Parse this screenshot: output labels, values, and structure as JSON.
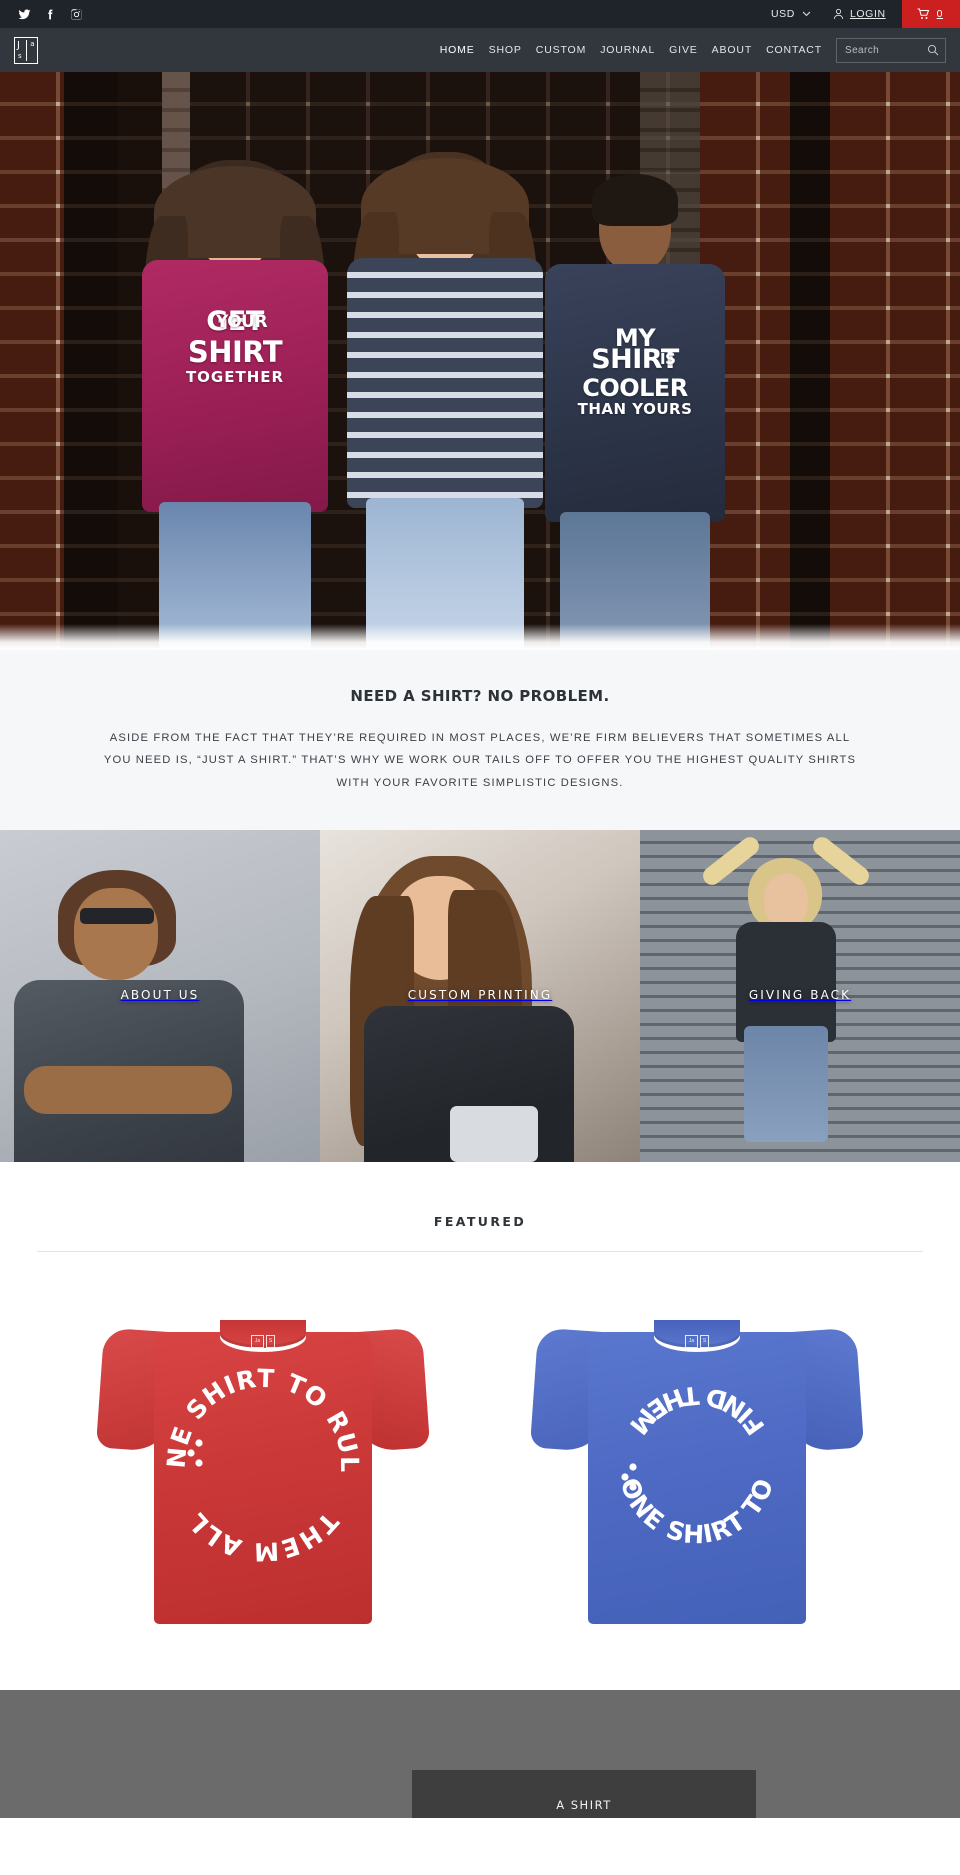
{
  "topbar": {
    "social": [
      {
        "name": "twitter-icon",
        "label": "Twitter"
      },
      {
        "name": "facebook-icon",
        "label": "Facebook"
      },
      {
        "name": "instagram-icon",
        "label": "Instagram"
      }
    ],
    "currency": "USD",
    "login_label": "LOGIN",
    "cart_count": "0",
    "cart_color": "#cc1f1f",
    "background": "#1f242b"
  },
  "header": {
    "background": "#32373e",
    "logo": {
      "line1": "J",
      "line2": "a",
      "line3": "s"
    },
    "nav": [
      {
        "label": "HOME",
        "active": true
      },
      {
        "label": "SHOP",
        "active": false
      },
      {
        "label": "CUSTOM",
        "active": false
      },
      {
        "label": "JOURNAL",
        "active": false
      },
      {
        "label": "GIVE",
        "active": false
      },
      {
        "label": "ABOUT",
        "active": false
      },
      {
        "label": "CONTACT",
        "active": false
      }
    ],
    "search": {
      "placeholder": "Search",
      "value": ""
    }
  },
  "hero": {
    "shirts": [
      {
        "line1": "GET",
        "line2": "YOUR",
        "line3": "SHIRT",
        "line4": "TOGETHER",
        "color": "#a3245a"
      },
      {
        "line1": "",
        "line2": "",
        "line3": "",
        "line4": "",
        "color": "#3c4458"
      },
      {
        "line1": "MY",
        "line2": "SHIRT",
        "line3": "IS",
        "line4": "COOLER",
        "line5": "THAN YOURS",
        "color": "#2e3748"
      }
    ]
  },
  "intro": {
    "heading": "NEED A SHIRT? NO PROBLEM.",
    "body": "ASIDE FROM THE FACT THAT THEY’RE REQUIRED IN MOST PLACES, WE’RE FIRM BELIEVERS THAT SOMETIMES ALL YOU NEED IS, “JUST A SHIRT.” THAT’S WHY WE WORK OUR TAILS OFF TO OFFER YOU THE HIGHEST QUALITY SHIRTS WITH YOUR FAVORITE SIMPLISTIC DESIGNS.",
    "background": "#f6f7f8"
  },
  "tiles": [
    {
      "label": "ABOUT US"
    },
    {
      "label": "CUSTOM PRINTING"
    },
    {
      "label": "GIVING BACK"
    }
  ],
  "featured": {
    "heading": "FEATURED",
    "products": [
      {
        "name": "One Shirt To Rule Them All",
        "color": "#cf3a3a",
        "circle_top": "ONE SHIRT TO RULE",
        "circle_bottom": "THEM ALL",
        "tag_left": "Ja",
        "tag_right": "S"
      },
      {
        "name": "One Shirt To Find Them",
        "color": "#4f6cc4",
        "circle_top": "FIND THEM",
        "circle_bottom": "ONE SHIRT TO",
        "tag_left": "Ja",
        "tag_right": "S"
      }
    ]
  },
  "bottom": {
    "background": "#6b6b6b",
    "panel_label": "A SHIRT",
    "panel_color": "#3e3e3e"
  }
}
